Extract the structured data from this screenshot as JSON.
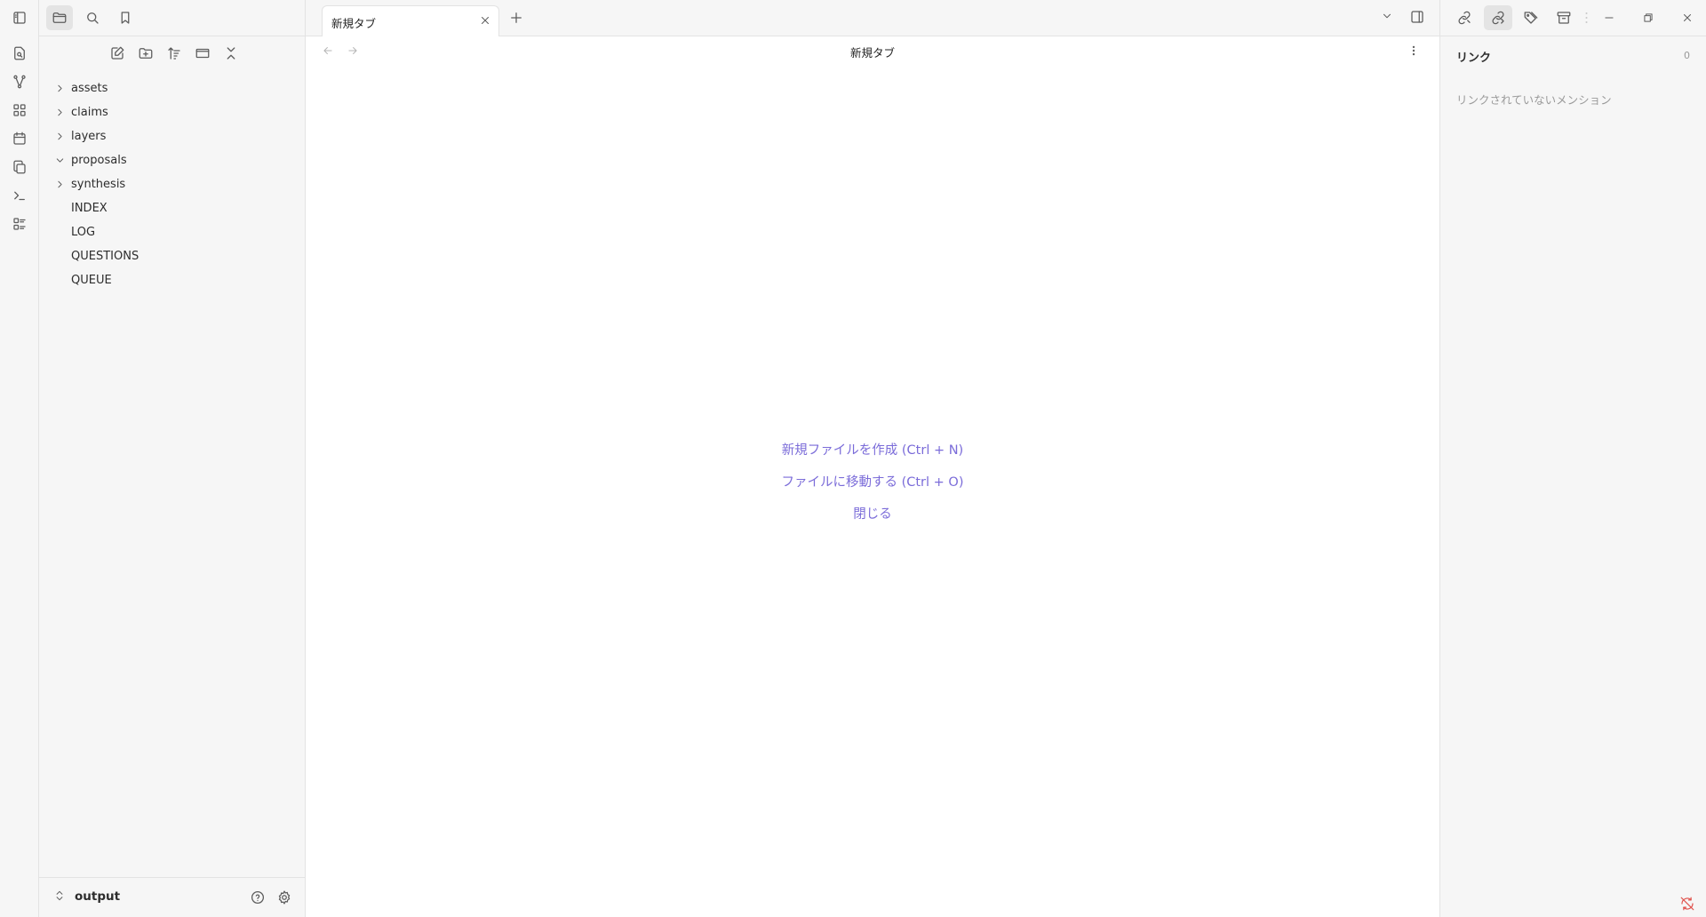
{
  "left_sidebar": {
    "file_tree": [
      {
        "label": "assets",
        "type": "folder",
        "expanded": false
      },
      {
        "label": "claims",
        "type": "folder",
        "expanded": false
      },
      {
        "label": "layers",
        "type": "folder",
        "expanded": false
      },
      {
        "label": "proposals",
        "type": "folder",
        "expanded": true
      },
      {
        "label": "synthesis",
        "type": "folder",
        "expanded": false
      },
      {
        "label": "INDEX",
        "type": "file"
      },
      {
        "label": "LOG",
        "type": "file"
      },
      {
        "label": "QUESTIONS",
        "type": "file"
      },
      {
        "label": "QUEUE",
        "type": "file"
      }
    ],
    "vault_name": "output"
  },
  "main": {
    "tab_title": "新規タブ",
    "view_title": "新規タブ",
    "empty_actions": {
      "create_file": "新規ファイルを作成 (Ctrl + N)",
      "go_to_file": "ファイルに移動する (Ctrl + O)",
      "close": "閉じる"
    }
  },
  "right_sidebar": {
    "links_title": "リンク",
    "links_count": "0",
    "unlinked_title": "リンクされていないメンション"
  },
  "colors": {
    "accent": "#7b6cd9",
    "sidebar_bg": "#f6f6f6",
    "border": "#e3e3e3",
    "sync_error": "#e0504a"
  }
}
